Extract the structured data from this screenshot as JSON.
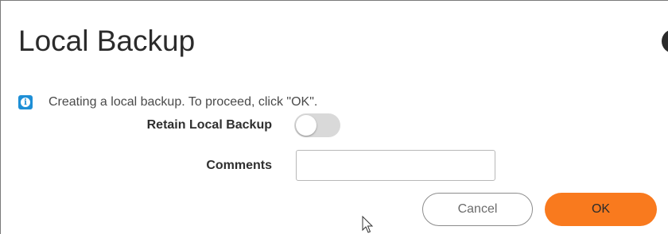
{
  "dialog": {
    "title": "Local Backup",
    "info_message": "Creating a local backup. To proceed, click \"OK\".",
    "info_icon": "info-icon",
    "fields": {
      "retain_label": "Retain Local Backup",
      "retain_enabled": false,
      "comments_label": "Comments",
      "comments_value": ""
    },
    "buttons": {
      "cancel_label": "Cancel",
      "ok_label": "OK"
    }
  },
  "colors": {
    "accent_ok": "#f97a1e",
    "info_blue": "#1e8fd6",
    "toggle_off": "#d9d9d9"
  }
}
